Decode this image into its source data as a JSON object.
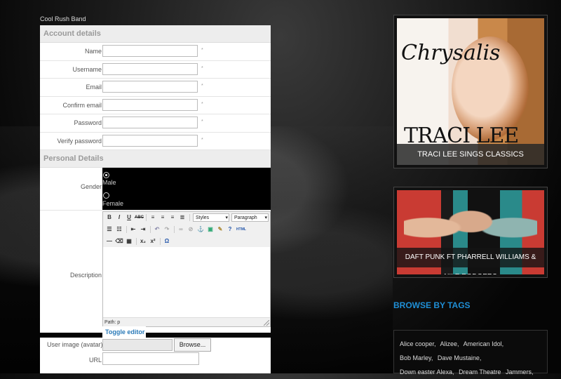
{
  "site_title": "Cool Rush Band",
  "account": {
    "heading": "Account details",
    "fields": [
      {
        "label": "Name",
        "required": "*"
      },
      {
        "label": "Username",
        "required": "*"
      },
      {
        "label": "Email",
        "required": "*"
      },
      {
        "label": "Confirm email",
        "required": "*"
      },
      {
        "label": "Password",
        "required": "*"
      },
      {
        "label": "Verify password",
        "required": "*"
      }
    ]
  },
  "personal": {
    "heading": "Personal Details",
    "gender_label": "Gender",
    "gender_options": [
      {
        "label": "Male",
        "selected": true
      },
      {
        "label": "Female",
        "selected": false
      }
    ],
    "description_label": "Description",
    "editor": {
      "styles_select": "Styles",
      "paragraph_select": "Paragraph",
      "path": "Path: p"
    },
    "toggle_editor": "Toggle editor",
    "user_image_label": "User image (avatar)",
    "browse_button": "Browse...",
    "url_label": "URL"
  },
  "sidebar": {
    "promo1_art_title": "Chrysalis",
    "promo1_art_name": "TRACI LEE",
    "promo1_caption": "TRACI LEE SINGS CLASSICS",
    "promo2_caption": "DAFT PUNK FT PHARRELL WILLIAMS & NILE RODGERS",
    "tags_heading": "BROWSE BY TAGS",
    "tags": [
      "Alice cooper,",
      "Alizee,",
      "American Idol,",
      "Bob Marley,",
      "Dave Mustaine,",
      "Down easter Alexa,",
      "Dream Theatre",
      "Jammers,"
    ]
  }
}
